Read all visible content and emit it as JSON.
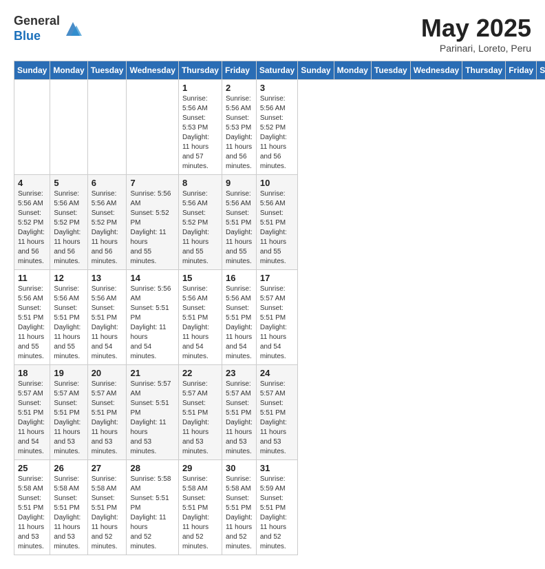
{
  "logo": {
    "general": "General",
    "blue": "Blue"
  },
  "title": {
    "month_year": "May 2025",
    "location": "Parinari, Loreto, Peru"
  },
  "days_of_week": [
    "Sunday",
    "Monday",
    "Tuesday",
    "Wednesday",
    "Thursday",
    "Friday",
    "Saturday"
  ],
  "weeks": [
    [
      {
        "day": "",
        "info": ""
      },
      {
        "day": "",
        "info": ""
      },
      {
        "day": "",
        "info": ""
      },
      {
        "day": "",
        "info": ""
      },
      {
        "day": "1",
        "info": "Sunrise: 5:56 AM\nSunset: 5:53 PM\nDaylight: 11 hours\nand 57 minutes."
      },
      {
        "day": "2",
        "info": "Sunrise: 5:56 AM\nSunset: 5:53 PM\nDaylight: 11 hours\nand 56 minutes."
      },
      {
        "day": "3",
        "info": "Sunrise: 5:56 AM\nSunset: 5:52 PM\nDaylight: 11 hours\nand 56 minutes."
      }
    ],
    [
      {
        "day": "4",
        "info": "Sunrise: 5:56 AM\nSunset: 5:52 PM\nDaylight: 11 hours\nand 56 minutes."
      },
      {
        "day": "5",
        "info": "Sunrise: 5:56 AM\nSunset: 5:52 PM\nDaylight: 11 hours\nand 56 minutes."
      },
      {
        "day": "6",
        "info": "Sunrise: 5:56 AM\nSunset: 5:52 PM\nDaylight: 11 hours\nand 56 minutes."
      },
      {
        "day": "7",
        "info": "Sunrise: 5:56 AM\nSunset: 5:52 PM\nDaylight: 11 hours\nand 55 minutes."
      },
      {
        "day": "8",
        "info": "Sunrise: 5:56 AM\nSunset: 5:52 PM\nDaylight: 11 hours\nand 55 minutes."
      },
      {
        "day": "9",
        "info": "Sunrise: 5:56 AM\nSunset: 5:51 PM\nDaylight: 11 hours\nand 55 minutes."
      },
      {
        "day": "10",
        "info": "Sunrise: 5:56 AM\nSunset: 5:51 PM\nDaylight: 11 hours\nand 55 minutes."
      }
    ],
    [
      {
        "day": "11",
        "info": "Sunrise: 5:56 AM\nSunset: 5:51 PM\nDaylight: 11 hours\nand 55 minutes."
      },
      {
        "day": "12",
        "info": "Sunrise: 5:56 AM\nSunset: 5:51 PM\nDaylight: 11 hours\nand 55 minutes."
      },
      {
        "day": "13",
        "info": "Sunrise: 5:56 AM\nSunset: 5:51 PM\nDaylight: 11 hours\nand 54 minutes."
      },
      {
        "day": "14",
        "info": "Sunrise: 5:56 AM\nSunset: 5:51 PM\nDaylight: 11 hours\nand 54 minutes."
      },
      {
        "day": "15",
        "info": "Sunrise: 5:56 AM\nSunset: 5:51 PM\nDaylight: 11 hours\nand 54 minutes."
      },
      {
        "day": "16",
        "info": "Sunrise: 5:56 AM\nSunset: 5:51 PM\nDaylight: 11 hours\nand 54 minutes."
      },
      {
        "day": "17",
        "info": "Sunrise: 5:57 AM\nSunset: 5:51 PM\nDaylight: 11 hours\nand 54 minutes."
      }
    ],
    [
      {
        "day": "18",
        "info": "Sunrise: 5:57 AM\nSunset: 5:51 PM\nDaylight: 11 hours\nand 54 minutes."
      },
      {
        "day": "19",
        "info": "Sunrise: 5:57 AM\nSunset: 5:51 PM\nDaylight: 11 hours\nand 53 minutes."
      },
      {
        "day": "20",
        "info": "Sunrise: 5:57 AM\nSunset: 5:51 PM\nDaylight: 11 hours\nand 53 minutes."
      },
      {
        "day": "21",
        "info": "Sunrise: 5:57 AM\nSunset: 5:51 PM\nDaylight: 11 hours\nand 53 minutes."
      },
      {
        "day": "22",
        "info": "Sunrise: 5:57 AM\nSunset: 5:51 PM\nDaylight: 11 hours\nand 53 minutes."
      },
      {
        "day": "23",
        "info": "Sunrise: 5:57 AM\nSunset: 5:51 PM\nDaylight: 11 hours\nand 53 minutes."
      },
      {
        "day": "24",
        "info": "Sunrise: 5:57 AM\nSunset: 5:51 PM\nDaylight: 11 hours\nand 53 minutes."
      }
    ],
    [
      {
        "day": "25",
        "info": "Sunrise: 5:58 AM\nSunset: 5:51 PM\nDaylight: 11 hours\nand 53 minutes."
      },
      {
        "day": "26",
        "info": "Sunrise: 5:58 AM\nSunset: 5:51 PM\nDaylight: 11 hours\nand 53 minutes."
      },
      {
        "day": "27",
        "info": "Sunrise: 5:58 AM\nSunset: 5:51 PM\nDaylight: 11 hours\nand 52 minutes."
      },
      {
        "day": "28",
        "info": "Sunrise: 5:58 AM\nSunset: 5:51 PM\nDaylight: 11 hours\nand 52 minutes."
      },
      {
        "day": "29",
        "info": "Sunrise: 5:58 AM\nSunset: 5:51 PM\nDaylight: 11 hours\nand 52 minutes."
      },
      {
        "day": "30",
        "info": "Sunrise: 5:58 AM\nSunset: 5:51 PM\nDaylight: 11 hours\nand 52 minutes."
      },
      {
        "day": "31",
        "info": "Sunrise: 5:59 AM\nSunset: 5:51 PM\nDaylight: 11 hours\nand 52 minutes."
      }
    ]
  ]
}
